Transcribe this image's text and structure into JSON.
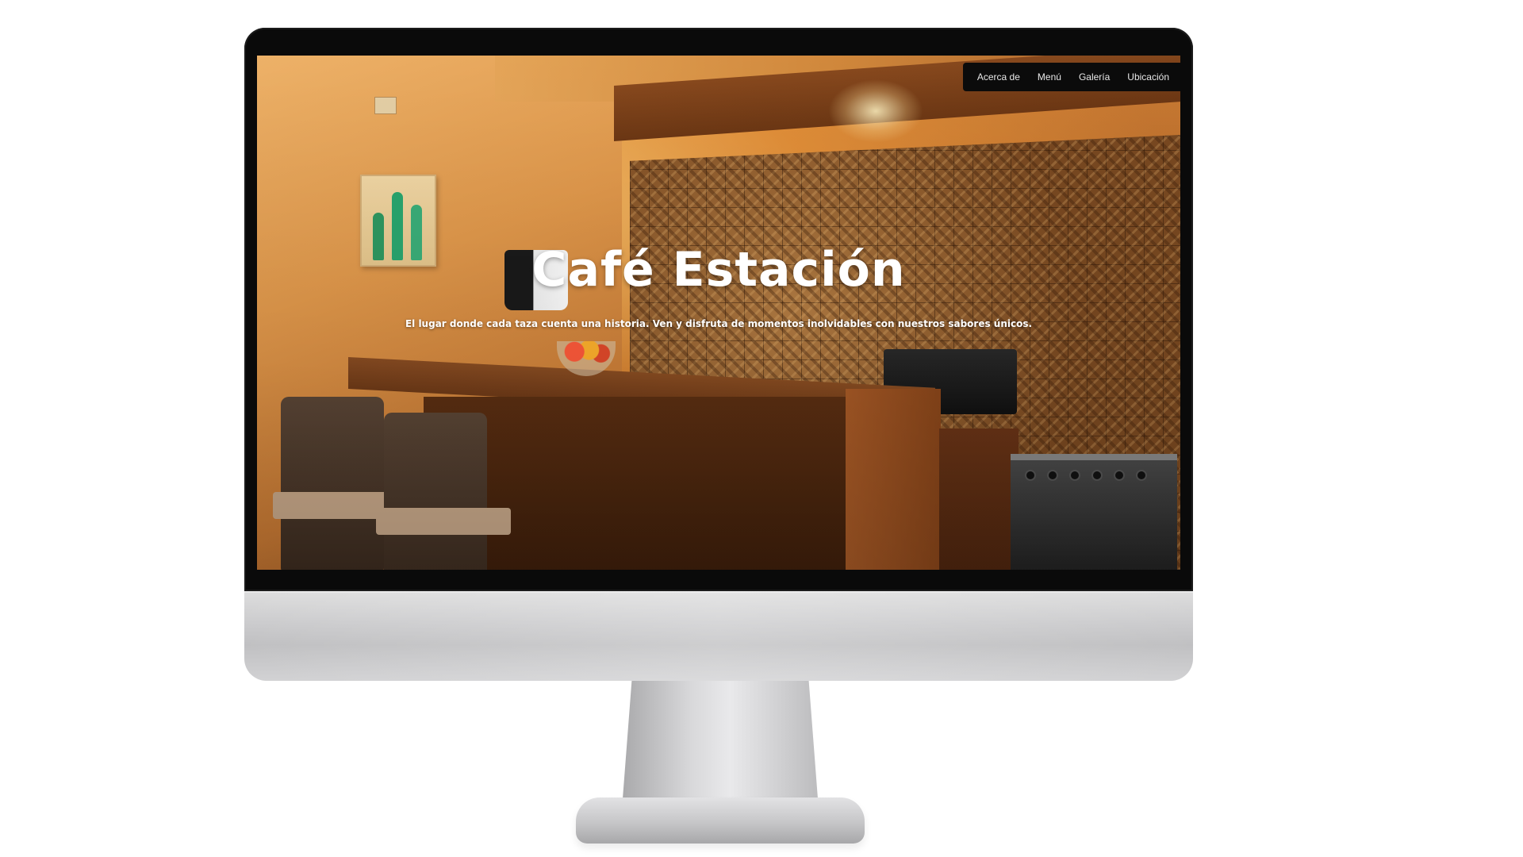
{
  "nav": {
    "items": [
      {
        "label": "Acerca de"
      },
      {
        "label": "Menú"
      },
      {
        "label": "Galería"
      },
      {
        "label": "Ubicación"
      }
    ]
  },
  "hero": {
    "title": "Café Estación",
    "subtitle": "El lugar donde cada taza cuenta una historia. Ven y disfruta de momentos inolvidables con nuestros sabores únicos."
  },
  "colors": {
    "navbar_bg": "#0b0b0b",
    "nav_text": "#e8e8e8",
    "hero_text": "#ffffff",
    "monitor_bezel": "#0a0a0a",
    "monitor_body": "#c9c9cb"
  },
  "background_image": {
    "subject": "cafe-interior-photo"
  }
}
